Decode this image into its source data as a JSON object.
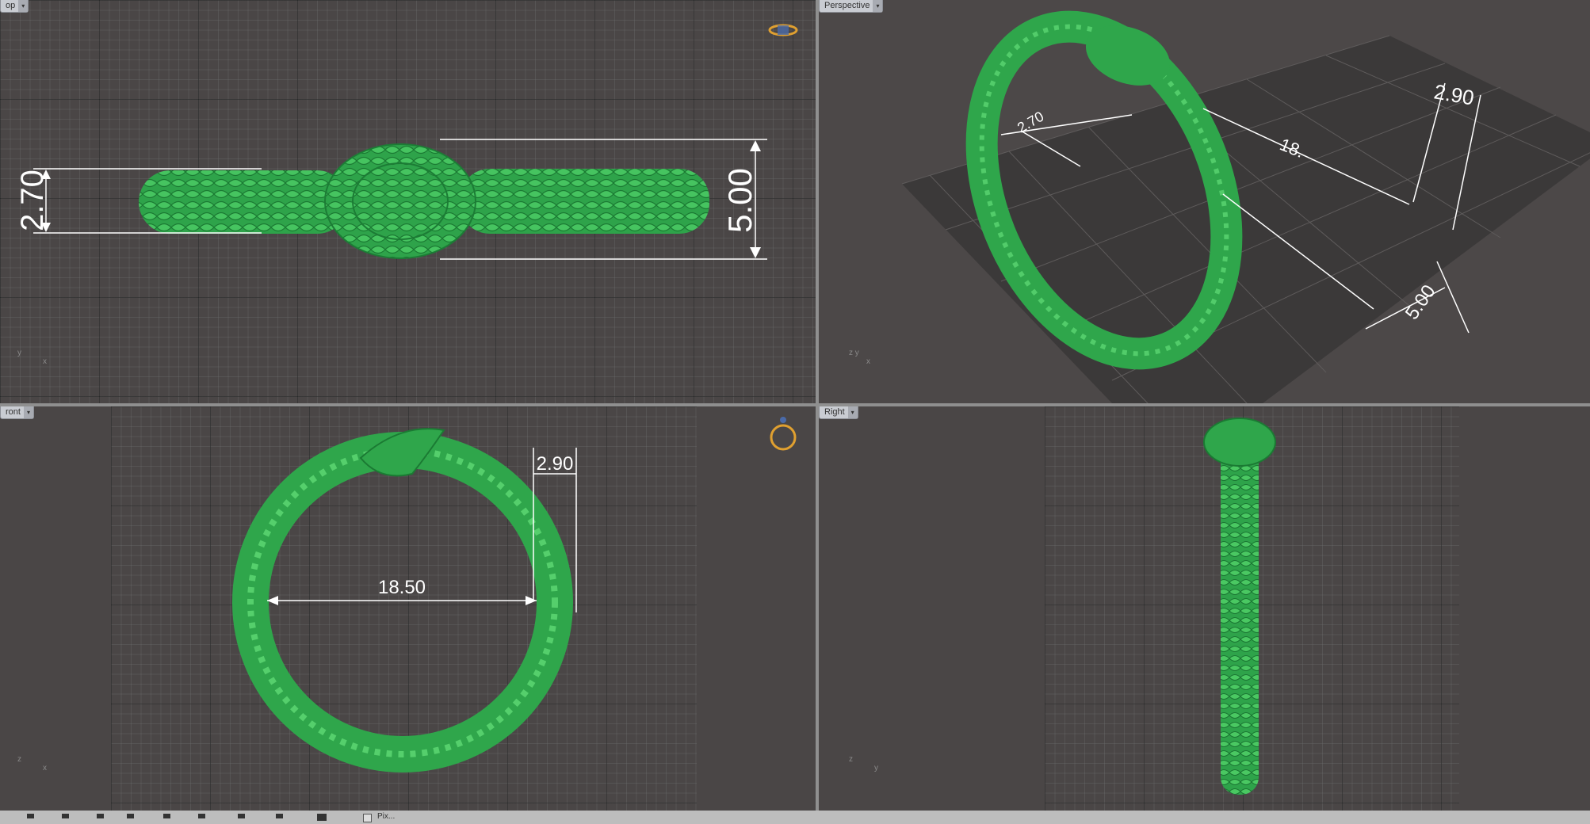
{
  "viewports": {
    "top": {
      "label": "op"
    },
    "perspective": {
      "label": "Perspective"
    },
    "front": {
      "label": "ront"
    },
    "right": {
      "label": "Right"
    }
  },
  "dimensions": {
    "top_left_height": "2.70",
    "top_right_height": "5.00",
    "persp_a": "2.70",
    "persp_b": "18.",
    "persp_c": "2.90",
    "persp_d": "5.00",
    "front_inner_diameter": "18.50",
    "front_width": "2.90"
  },
  "axes": {
    "top": [
      "y",
      "x"
    ],
    "perspective": [
      "z",
      "y",
      "x"
    ],
    "front": [
      "z",
      "x"
    ],
    "right": [
      "z",
      "y"
    ]
  },
  "statusbar": {
    "option_label": "Pix..."
  },
  "colors": {
    "model": "#2fa64b",
    "dimension": "#ffffff",
    "gizmo": "#e0a030"
  }
}
